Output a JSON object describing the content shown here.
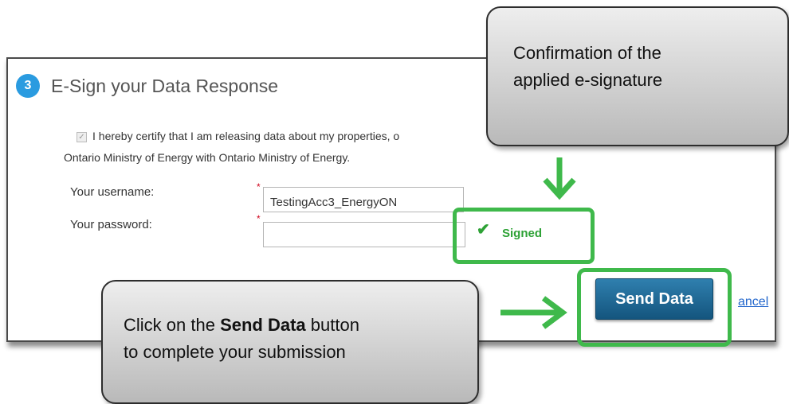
{
  "step": {
    "number": "3",
    "title": "E-Sign your Data Response"
  },
  "certify": {
    "line1": "I hereby certify that I am releasing data about my properties, o",
    "line2": "Ontario Ministry of Energy with Ontario Ministry of Energy.",
    "checked": true
  },
  "form": {
    "username_label": "Your username:",
    "username_value": "TestingAcc3_EnergyON",
    "password_label": "Your password:",
    "password_value": ""
  },
  "status": {
    "signed": "Signed"
  },
  "buttons": {
    "send": "Send Data",
    "cancel": "ancel"
  },
  "callouts": {
    "top_line1": "Confirmation of the",
    "top_line2": "applied e-signature",
    "bottom_pre": "Click on the ",
    "bottom_bold": "Send Data",
    "bottom_post": " button",
    "bottom_line2": "to complete your submission"
  },
  "colors": {
    "highlight_green": "#3fb94b",
    "step_badge": "#2a9be0",
    "send_button": "#14557e"
  }
}
